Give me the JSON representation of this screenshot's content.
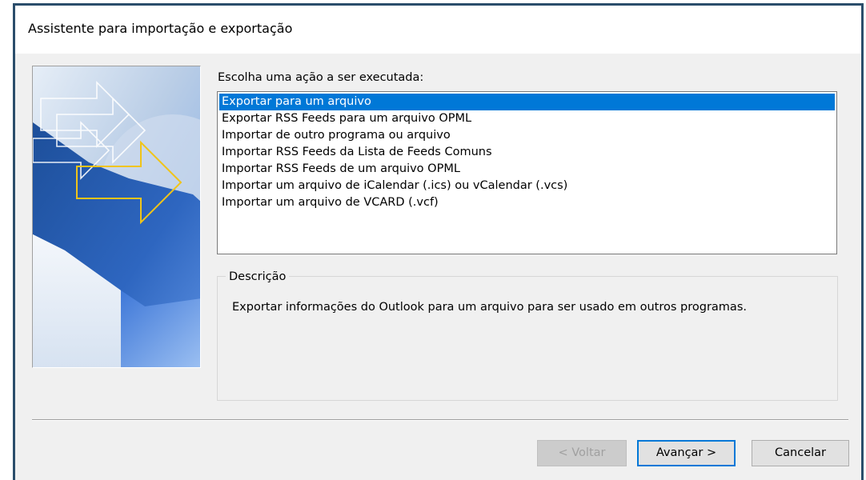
{
  "window": {
    "title": "Assistente para importação e exportação"
  },
  "main": {
    "choose_label": "Escolha uma ação a ser executada:",
    "actions": [
      {
        "label": "Exportar para um arquivo",
        "selected": true
      },
      {
        "label": "Exportar RSS Feeds para um arquivo OPML",
        "selected": false
      },
      {
        "label": "Importar de outro programa ou arquivo",
        "selected": false
      },
      {
        "label": "Importar RSS Feeds da Lista de Feeds Comuns",
        "selected": false
      },
      {
        "label": "Importar RSS Feeds de um arquivo OPML",
        "selected": false
      },
      {
        "label": "Importar um arquivo de iCalendar (.ics) ou vCalendar (.vcs)",
        "selected": false
      },
      {
        "label": "Importar um arquivo de VCARD (.vcf)",
        "selected": false
      }
    ],
    "description": {
      "legend": "Descrição",
      "text": "Exportar informações do Outlook para um arquivo para ser usado em outros programas."
    }
  },
  "buttons": {
    "back": "< Voltar",
    "next": "Avançar >",
    "cancel": "Cancelar"
  },
  "colors": {
    "selection": "#0078d7",
    "dialog_background": "#f0f0f0",
    "window_border": "#2b4d6b",
    "arrow_accent": "#f0c419"
  },
  "icons": {
    "wizard_banner": "arrow-graphic"
  }
}
